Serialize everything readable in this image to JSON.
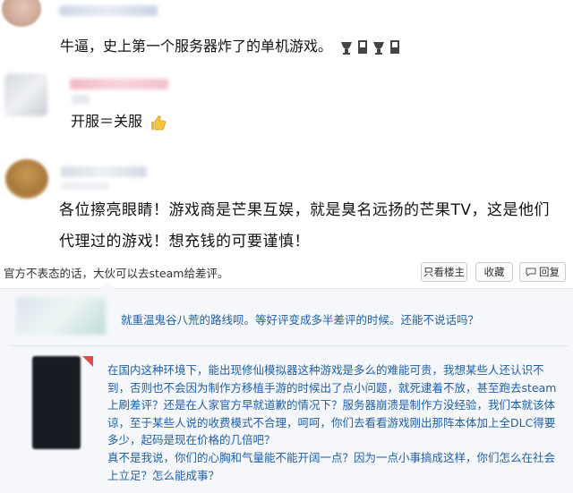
{
  "comments": [
    {
      "text": "牛逼，史上第一个服务器炸了的单机游戏。"
    },
    {
      "text": "开服＝关服"
    },
    {
      "line1": "各位擦亮眼睛！游戏商是芒果互娱，就是臭名远扬的芒果TV，这是他们",
      "line2": "代理过的游戏！想充钱的可要谨慎！"
    }
  ],
  "featured_comment": {
    "text": "官方不表态的话，大伙可以去steam给差评。",
    "buttons": {
      "owner_only": "只看楼主",
      "collect": "收藏",
      "reply": "回复"
    }
  },
  "reply1": {
    "text": "就重温鬼谷八荒的路线呗。等好评变成多半差评的时候。还能不说话吗？"
  },
  "reply2": {
    "lines": [
      "在国内这种环境下，能出现修仙模拟器这种游戏是多么的难能可贵，我想某些人还认识不",
      "到，否则也不会因为制作方移植手游的时候出了点小问题，就死逮着不放，甚至跑去steam",
      "上刷差评？还是在人家官方早就道歉的情况下？服务器崩溃是制作方没经验，我们本就该体",
      "谅，至于某些人说的收费模式不合理，呵呵，你们去看看游戏刚出那阵本体加上全DLC得要",
      "多少，起码是现在价格的几倍吧？",
      "真不是我说，你们的心胸和气量能不能开阔一点？因为一点小事搞成这样，你们怎么在社会",
      "上立足？怎么能成事？"
    ]
  },
  "icons": [
    "thumbs-up-icon",
    "reply-icon",
    "emoji-icon"
  ],
  "colors": {
    "link_blue": "#1f5fa8",
    "text": "#111111",
    "button_border": "#cccccc"
  }
}
